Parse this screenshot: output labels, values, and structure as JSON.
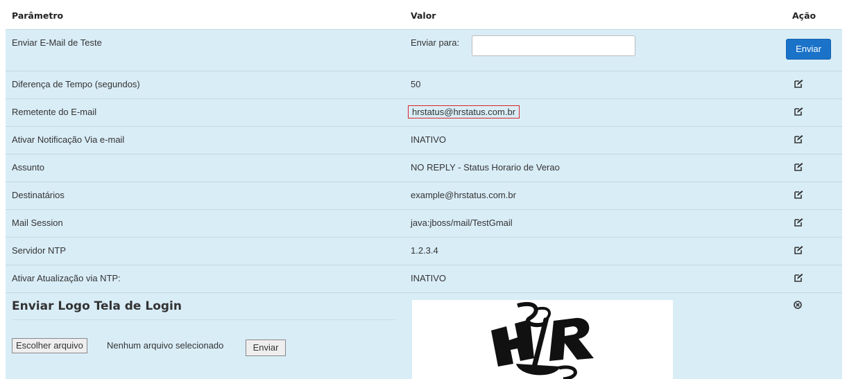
{
  "header": {
    "col1": "Parâmetro",
    "col2": "Valor",
    "col3": "Ação"
  },
  "test_mail": {
    "label": "Enviar E-Mail de Teste",
    "send_to_label": "Enviar para:",
    "send_to_value": "",
    "button": "Enviar"
  },
  "rows": [
    {
      "label": "Diferença de Tempo (segundos)",
      "value": "50"
    },
    {
      "label": "Remetente do E-mail",
      "value": "hrstatus@hrstatus.com.br"
    },
    {
      "label": "Ativar Notificação Via e-mail",
      "value": "INATIVO"
    },
    {
      "label": "Assunto",
      "value": "NO REPLY - Status Horario de Verao"
    },
    {
      "label": "Destinatários",
      "value": "example@hrstatus.com.br"
    },
    {
      "label": "Mail Session",
      "value": "java:jboss/mail/TestGmail"
    },
    {
      "label": "Servidor NTP",
      "value": "1.2.3.4"
    },
    {
      "label": "Ativar Atualização via NTP:",
      "value": "INATIVO"
    }
  ],
  "logo_section": {
    "title": "Enviar Logo Tela de Login",
    "choose_file": "Escolher arquivo",
    "no_file": "Nenhum arquivo selecionado",
    "send": "Enviar"
  },
  "colors": {
    "row_bg": "#d9edf7",
    "primary": "#1a73c8",
    "highlight_border": "#d9232d"
  }
}
